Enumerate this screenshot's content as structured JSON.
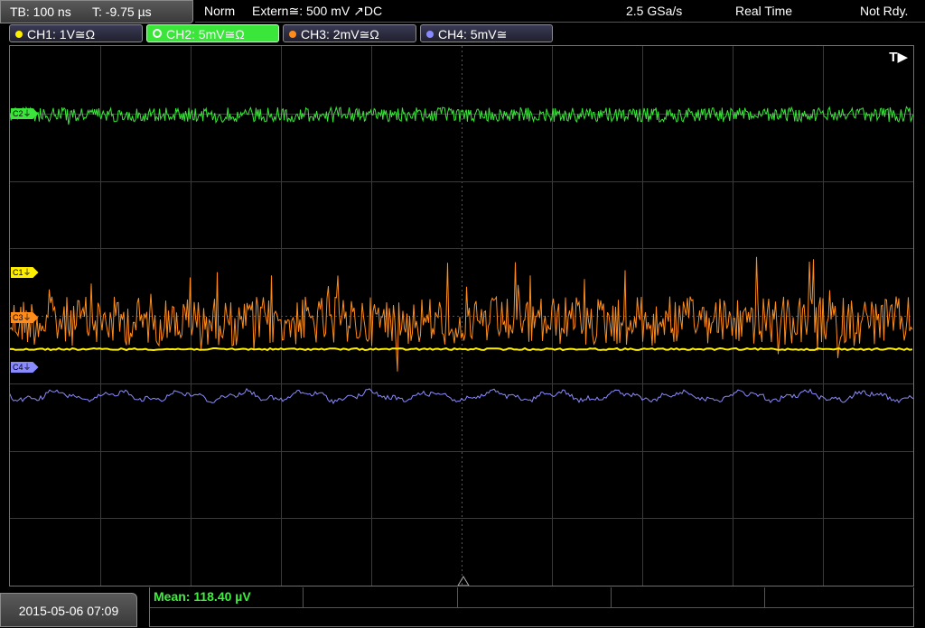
{
  "header": {
    "timebase": "TB: 100 ns",
    "trigger_time": "T: -9.75 µs",
    "mode": "Norm",
    "trigger_source": "Extern≅: 500 mV ↗DC",
    "sample_rate": "2.5 GSa/s",
    "acquisition": "Real Time",
    "status": "Not Rdy."
  },
  "channels": [
    {
      "label": "CH1: 1V≅Ω",
      "color": "#ffee00",
      "marker": "C1⏚"
    },
    {
      "label": "CH2: 5mV≅Ω",
      "color": "#39e639",
      "marker": "C2⏚",
      "active": true
    },
    {
      "label": "CH3: 2mV≅Ω",
      "color": "#ff8c1a",
      "marker": "C3⏚"
    },
    {
      "label": "CH4: 5mV≅",
      "color": "#8a8aff",
      "marker": "C4⏚"
    }
  ],
  "trigger_marker": "T▶",
  "measurement": {
    "mean": "Mean: 118.40 µV"
  },
  "datetime": "2015-05-06 07:09"
}
